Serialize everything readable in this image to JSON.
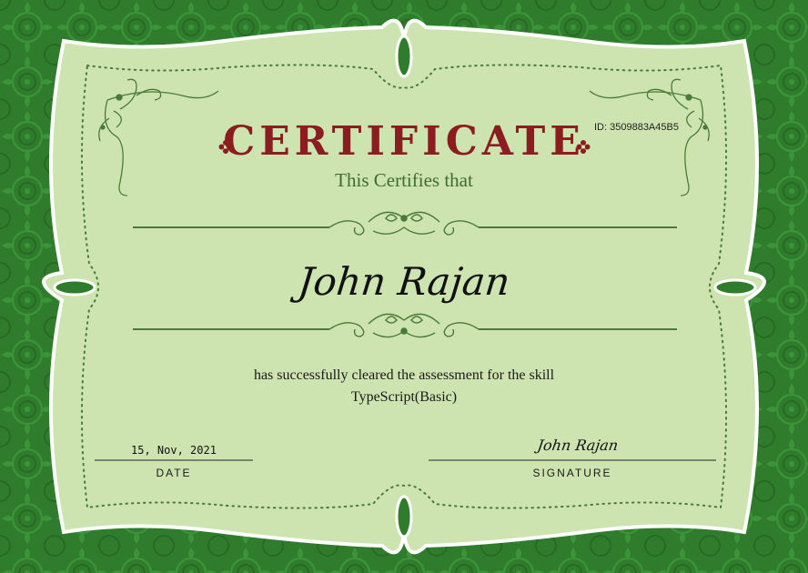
{
  "certificate": {
    "id_text": "ID: 3509883A45B5",
    "title": "CERTIFICATE",
    "subtitle": "This Certifies that",
    "recipient_name": "John Rajan",
    "statement_line1": "has successfully cleared the assessment for the skill",
    "statement_line2": "TypeScript(Basic)",
    "date_value": "15, Nov, 2021",
    "date_label": "DATE",
    "signature_value": "John Rajan",
    "signature_label": "SIGNATURE"
  },
  "colors": {
    "background": "#2f7d2c",
    "panel": "#cde4b0",
    "title": "#8b1c20",
    "accent_green": "#4a7a3a"
  },
  "icons": [
    "flourish-corner-icon",
    "flower-icon",
    "scroll-divider-icon"
  ]
}
